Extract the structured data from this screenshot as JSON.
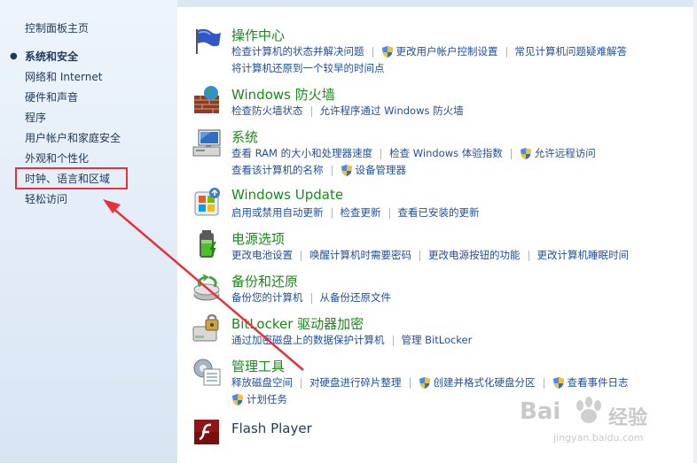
{
  "sidebar": {
    "home": "控制面板主页",
    "items": [
      {
        "label": "系统和安全",
        "active": true
      },
      {
        "label": "网络和 Internet"
      },
      {
        "label": "硬件和声音"
      },
      {
        "label": "程序"
      },
      {
        "label": "用户帐户和家庭安全"
      },
      {
        "label": "外观和个性化"
      },
      {
        "label": "时钟、语言和区域"
      },
      {
        "label": "轻松访问"
      }
    ],
    "bullet": "●"
  },
  "sections": [
    {
      "id": "action-center",
      "title": "操作中心",
      "icon": "flag-icon",
      "rows": [
        [
          {
            "t": "检查计算机的状态并解决问题"
          },
          {
            "t": "更改用户帐户控制设置",
            "shield": true
          },
          {
            "t": "常见计算机问题疑难解答"
          }
        ],
        [
          {
            "t": "将计算机还原到一个较早的时间点"
          }
        ]
      ]
    },
    {
      "id": "firewall",
      "title": "Windows 防火墙",
      "icon": "firewall-icon",
      "rows": [
        [
          {
            "t": "检查防火墙状态"
          },
          {
            "t": "允许程序通过 Windows 防火墙"
          }
        ]
      ]
    },
    {
      "id": "system",
      "title": "系统",
      "icon": "computer-icon",
      "rows": [
        [
          {
            "t": "查看 RAM 的大小和处理器速度"
          },
          {
            "t": "检查 Windows 体验指数"
          },
          {
            "t": "允许远程访问",
            "shield": true
          }
        ],
        [
          {
            "t": "查看该计算机的名称"
          },
          {
            "t": "设备管理器",
            "shield": true
          }
        ]
      ]
    },
    {
      "id": "windows-update",
      "title": "Windows Update",
      "icon": "windows-update-icon",
      "rows": [
        [
          {
            "t": "启用或禁用自动更新"
          },
          {
            "t": "检查更新"
          },
          {
            "t": "查看已安装的更新"
          }
        ]
      ]
    },
    {
      "id": "power",
      "title": "电源选项",
      "icon": "battery-icon",
      "rows": [
        [
          {
            "t": "更改电池设置"
          },
          {
            "t": "唤醒计算机时需要密码"
          },
          {
            "t": "更改电源按钮的功能"
          },
          {
            "t": "更改计算机睡眠时间"
          }
        ]
      ]
    },
    {
      "id": "backup",
      "title": "备份和还原",
      "icon": "backup-icon",
      "rows": [
        [
          {
            "t": "备份您的计算机"
          },
          {
            "t": "从备份还原文件"
          }
        ]
      ]
    },
    {
      "id": "bitlocker",
      "title": "BitLocker 驱动器加密",
      "icon": "bitlocker-icon",
      "rows": [
        [
          {
            "t": "通过加密磁盘上的数据保护计算机"
          },
          {
            "t": "管理 BitLocker"
          }
        ]
      ]
    },
    {
      "id": "admin-tools",
      "title": "管理工具",
      "icon": "admin-tools-icon",
      "rows": [
        [
          {
            "t": "释放磁盘空间"
          },
          {
            "t": "对硬盘进行碎片整理"
          },
          {
            "t": "创建并格式化硬盘分区",
            "shield": true
          },
          {
            "t": "查看事件日志",
            "shield": true
          }
        ],
        [
          {
            "t": "计划任务",
            "shield": true
          }
        ]
      ]
    },
    {
      "id": "flash",
      "title": "Flash Player",
      "icon": "flash-player-icon",
      "rows": []
    }
  ],
  "watermark": {
    "brand": "Bai",
    "brand2": "经验",
    "url": "jingyan.baidu.com"
  },
  "colors": {
    "title": "#1a8a1a",
    "link": "#1f4f9a",
    "annotation": "#e8303a"
  }
}
